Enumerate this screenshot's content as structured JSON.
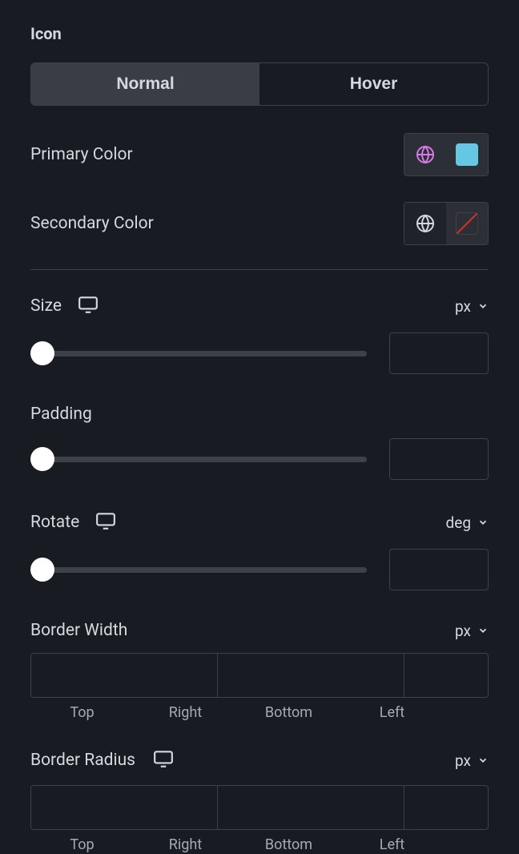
{
  "section_title": "Icon",
  "tabs": {
    "normal": "Normal",
    "hover": "Hover"
  },
  "primary_color": {
    "label": "Primary Color",
    "swatch": "#66c7e5"
  },
  "secondary_color": {
    "label": "Secondary Color"
  },
  "size": {
    "label": "Size",
    "unit": "px",
    "value": ""
  },
  "padding": {
    "label": "Padding",
    "value": ""
  },
  "rotate": {
    "label": "Rotate",
    "unit": "deg",
    "value": ""
  },
  "border_width": {
    "label": "Border Width",
    "unit": "px",
    "sides": [
      "Top",
      "Right",
      "Bottom",
      "Left"
    ]
  },
  "border_radius": {
    "label": "Border Radius",
    "unit": "px",
    "sides": [
      "Top",
      "Right",
      "Bottom",
      "Left"
    ]
  }
}
